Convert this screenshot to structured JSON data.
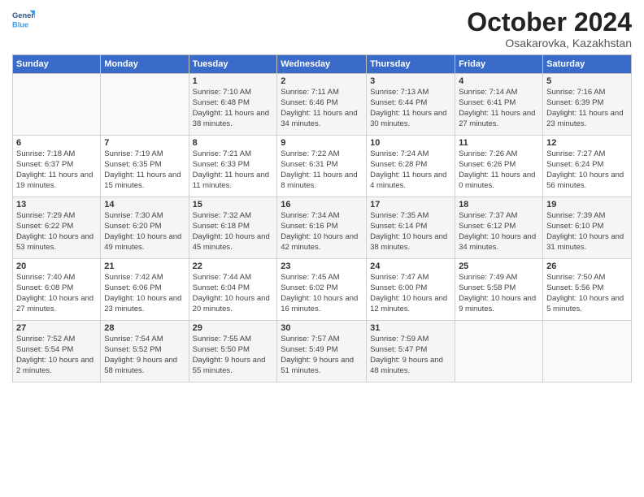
{
  "header": {
    "logo_line1": "General",
    "logo_line2": "Blue",
    "month": "October 2024",
    "location": "Osakarovka, Kazakhstan"
  },
  "weekdays": [
    "Sunday",
    "Monday",
    "Tuesday",
    "Wednesday",
    "Thursday",
    "Friday",
    "Saturday"
  ],
  "weeks": [
    [
      {
        "day": "",
        "sunrise": "",
        "sunset": "",
        "daylight": ""
      },
      {
        "day": "",
        "sunrise": "",
        "sunset": "",
        "daylight": ""
      },
      {
        "day": "1",
        "sunrise": "Sunrise: 7:10 AM",
        "sunset": "Sunset: 6:48 PM",
        "daylight": "Daylight: 11 hours and 38 minutes."
      },
      {
        "day": "2",
        "sunrise": "Sunrise: 7:11 AM",
        "sunset": "Sunset: 6:46 PM",
        "daylight": "Daylight: 11 hours and 34 minutes."
      },
      {
        "day": "3",
        "sunrise": "Sunrise: 7:13 AM",
        "sunset": "Sunset: 6:44 PM",
        "daylight": "Daylight: 11 hours and 30 minutes."
      },
      {
        "day": "4",
        "sunrise": "Sunrise: 7:14 AM",
        "sunset": "Sunset: 6:41 PM",
        "daylight": "Daylight: 11 hours and 27 minutes."
      },
      {
        "day": "5",
        "sunrise": "Sunrise: 7:16 AM",
        "sunset": "Sunset: 6:39 PM",
        "daylight": "Daylight: 11 hours and 23 minutes."
      }
    ],
    [
      {
        "day": "6",
        "sunrise": "Sunrise: 7:18 AM",
        "sunset": "Sunset: 6:37 PM",
        "daylight": "Daylight: 11 hours and 19 minutes."
      },
      {
        "day": "7",
        "sunrise": "Sunrise: 7:19 AM",
        "sunset": "Sunset: 6:35 PM",
        "daylight": "Daylight: 11 hours and 15 minutes."
      },
      {
        "day": "8",
        "sunrise": "Sunrise: 7:21 AM",
        "sunset": "Sunset: 6:33 PM",
        "daylight": "Daylight: 11 hours and 11 minutes."
      },
      {
        "day": "9",
        "sunrise": "Sunrise: 7:22 AM",
        "sunset": "Sunset: 6:31 PM",
        "daylight": "Daylight: 11 hours and 8 minutes."
      },
      {
        "day": "10",
        "sunrise": "Sunrise: 7:24 AM",
        "sunset": "Sunset: 6:28 PM",
        "daylight": "Daylight: 11 hours and 4 minutes."
      },
      {
        "day": "11",
        "sunrise": "Sunrise: 7:26 AM",
        "sunset": "Sunset: 6:26 PM",
        "daylight": "Daylight: 11 hours and 0 minutes."
      },
      {
        "day": "12",
        "sunrise": "Sunrise: 7:27 AM",
        "sunset": "Sunset: 6:24 PM",
        "daylight": "Daylight: 10 hours and 56 minutes."
      }
    ],
    [
      {
        "day": "13",
        "sunrise": "Sunrise: 7:29 AM",
        "sunset": "Sunset: 6:22 PM",
        "daylight": "Daylight: 10 hours and 53 minutes."
      },
      {
        "day": "14",
        "sunrise": "Sunrise: 7:30 AM",
        "sunset": "Sunset: 6:20 PM",
        "daylight": "Daylight: 10 hours and 49 minutes."
      },
      {
        "day": "15",
        "sunrise": "Sunrise: 7:32 AM",
        "sunset": "Sunset: 6:18 PM",
        "daylight": "Daylight: 10 hours and 45 minutes."
      },
      {
        "day": "16",
        "sunrise": "Sunrise: 7:34 AM",
        "sunset": "Sunset: 6:16 PM",
        "daylight": "Daylight: 10 hours and 42 minutes."
      },
      {
        "day": "17",
        "sunrise": "Sunrise: 7:35 AM",
        "sunset": "Sunset: 6:14 PM",
        "daylight": "Daylight: 10 hours and 38 minutes."
      },
      {
        "day": "18",
        "sunrise": "Sunrise: 7:37 AM",
        "sunset": "Sunset: 6:12 PM",
        "daylight": "Daylight: 10 hours and 34 minutes."
      },
      {
        "day": "19",
        "sunrise": "Sunrise: 7:39 AM",
        "sunset": "Sunset: 6:10 PM",
        "daylight": "Daylight: 10 hours and 31 minutes."
      }
    ],
    [
      {
        "day": "20",
        "sunrise": "Sunrise: 7:40 AM",
        "sunset": "Sunset: 6:08 PM",
        "daylight": "Daylight: 10 hours and 27 minutes."
      },
      {
        "day": "21",
        "sunrise": "Sunrise: 7:42 AM",
        "sunset": "Sunset: 6:06 PM",
        "daylight": "Daylight: 10 hours and 23 minutes."
      },
      {
        "day": "22",
        "sunrise": "Sunrise: 7:44 AM",
        "sunset": "Sunset: 6:04 PM",
        "daylight": "Daylight: 10 hours and 20 minutes."
      },
      {
        "day": "23",
        "sunrise": "Sunrise: 7:45 AM",
        "sunset": "Sunset: 6:02 PM",
        "daylight": "Daylight: 10 hours and 16 minutes."
      },
      {
        "day": "24",
        "sunrise": "Sunrise: 7:47 AM",
        "sunset": "Sunset: 6:00 PM",
        "daylight": "Daylight: 10 hours and 12 minutes."
      },
      {
        "day": "25",
        "sunrise": "Sunrise: 7:49 AM",
        "sunset": "Sunset: 5:58 PM",
        "daylight": "Daylight: 10 hours and 9 minutes."
      },
      {
        "day": "26",
        "sunrise": "Sunrise: 7:50 AM",
        "sunset": "Sunset: 5:56 PM",
        "daylight": "Daylight: 10 hours and 5 minutes."
      }
    ],
    [
      {
        "day": "27",
        "sunrise": "Sunrise: 7:52 AM",
        "sunset": "Sunset: 5:54 PM",
        "daylight": "Daylight: 10 hours and 2 minutes."
      },
      {
        "day": "28",
        "sunrise": "Sunrise: 7:54 AM",
        "sunset": "Sunset: 5:52 PM",
        "daylight": "Daylight: 9 hours and 58 minutes."
      },
      {
        "day": "29",
        "sunrise": "Sunrise: 7:55 AM",
        "sunset": "Sunset: 5:50 PM",
        "daylight": "Daylight: 9 hours and 55 minutes."
      },
      {
        "day": "30",
        "sunrise": "Sunrise: 7:57 AM",
        "sunset": "Sunset: 5:49 PM",
        "daylight": "Daylight: 9 hours and 51 minutes."
      },
      {
        "day": "31",
        "sunrise": "Sunrise: 7:59 AM",
        "sunset": "Sunset: 5:47 PM",
        "daylight": "Daylight: 9 hours and 48 minutes."
      },
      {
        "day": "",
        "sunrise": "",
        "sunset": "",
        "daylight": ""
      },
      {
        "day": "",
        "sunrise": "",
        "sunset": "",
        "daylight": ""
      }
    ]
  ]
}
